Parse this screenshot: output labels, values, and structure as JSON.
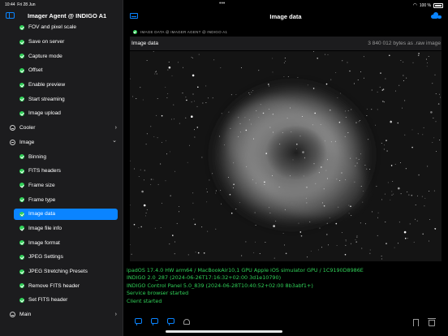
{
  "status": {
    "time": "10:44",
    "date": "Fri 28 Jun",
    "battery": "100 %"
  },
  "sidebar": {
    "title": "Imager Agent @ INDIGO A1",
    "items": [
      {
        "label": "FOV and pixel scale",
        "kind": "child",
        "status": "ok"
      },
      {
        "label": "Save on server",
        "kind": "child",
        "status": "ok"
      },
      {
        "label": "Capture mode",
        "kind": "child",
        "status": "ok"
      },
      {
        "label": "Offset",
        "kind": "child",
        "status": "ok"
      },
      {
        "label": "Enable preview",
        "kind": "child",
        "status": "ok"
      },
      {
        "label": "Start streaming",
        "kind": "child",
        "status": "ok"
      },
      {
        "label": "Image upload",
        "kind": "child",
        "status": "ok"
      },
      {
        "label": "Cooler",
        "kind": "group",
        "expanded": false
      },
      {
        "label": "Image",
        "kind": "group",
        "expanded": true
      },
      {
        "label": "Binning",
        "kind": "child",
        "status": "ok"
      },
      {
        "label": "FITS headers",
        "kind": "child",
        "status": "ok"
      },
      {
        "label": "Frame size",
        "kind": "child",
        "status": "ok"
      },
      {
        "label": "Frame type",
        "kind": "child",
        "status": "ok"
      },
      {
        "label": "Image data",
        "kind": "child",
        "status": "ok",
        "selected": true
      },
      {
        "label": "Image file info",
        "kind": "child",
        "status": "ok"
      },
      {
        "label": "Image format",
        "kind": "child",
        "status": "ok"
      },
      {
        "label": "JPEG Settings",
        "kind": "child",
        "status": "ok"
      },
      {
        "label": "JPEG Stretching Presets",
        "kind": "child",
        "status": "ok"
      },
      {
        "label": "Remove FITS header",
        "kind": "child",
        "status": "ok"
      },
      {
        "label": "Set FITS header",
        "kind": "child",
        "status": "ok"
      },
      {
        "label": "Main",
        "kind": "group",
        "expanded": false
      }
    ]
  },
  "main": {
    "title": "Image data",
    "agent_label": "IMAGE DATA @ IMAGER AGENT @ INDIGO A1",
    "image_label": "Image data",
    "image_size": "3 840 012 bytes as .raw image",
    "log": [
      "ipadOS 17.4.0 HW arm64 / MacBookAir10,1 GPU Apple iOS simulator GPU / 1C9190D8986E",
      "INDIGO 2.0_287 (2024-06-26T17:16:32+02:00 3d1e10790)",
      "INDIGO Control Panel 5.0_839 (2024-06-28T10:40:52+02:00 8b3abf1+)",
      "Service browser started",
      "Client started"
    ]
  },
  "colors": {
    "accent": "#0a84ff",
    "ok": "#30d158",
    "log": "#30d158",
    "sidebar_bg": "#1c1c1e"
  },
  "icons": [
    "sidebar-toggle-icon",
    "panel-icon",
    "cloud-connect-icon",
    "message-icon",
    "bell-icon",
    "bookmark-icon",
    "trash-icon"
  ]
}
